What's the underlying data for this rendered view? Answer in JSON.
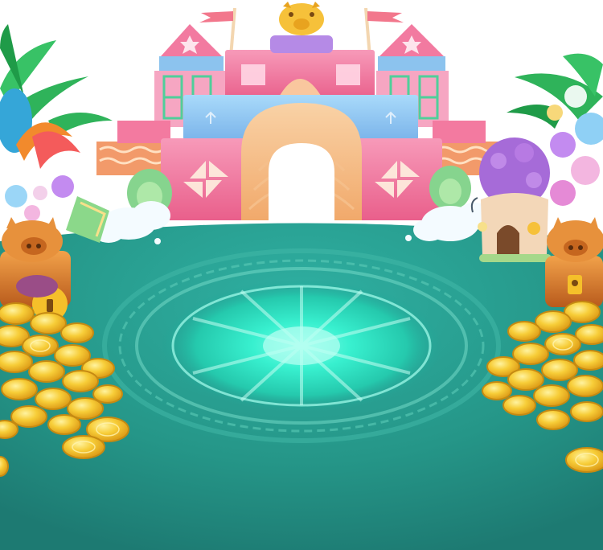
{
  "scene": {
    "type": "game-background",
    "background_color": "#ffffff",
    "palette": {
      "ground_light": "#2ba396",
      "ground_dark": "#1f7c74",
      "portal_glow": "#4dfbe0",
      "portal_ring": "#9cf0de",
      "castle_pink": "#f37fa4",
      "castle_blue": "#8fc8f3",
      "castle_peach": "#f8c89a",
      "coin_gold": "#f5c02a",
      "chest_orange": "#d67a2c",
      "flag_red": "#f2778c",
      "leaf_green": "#2fb35a",
      "flower_purple": "#a66bd8"
    },
    "icons": [
      "castle-icon",
      "pig-statue-icon",
      "pennant-flag-icon",
      "magic-circle-icon",
      "gold-coin-icon",
      "pig-treasure-chest-icon",
      "palm-tree-icon",
      "flower-bouquet-icon",
      "mushroom-house-icon",
      "cloud-icon",
      "bush-icon"
    ]
  }
}
